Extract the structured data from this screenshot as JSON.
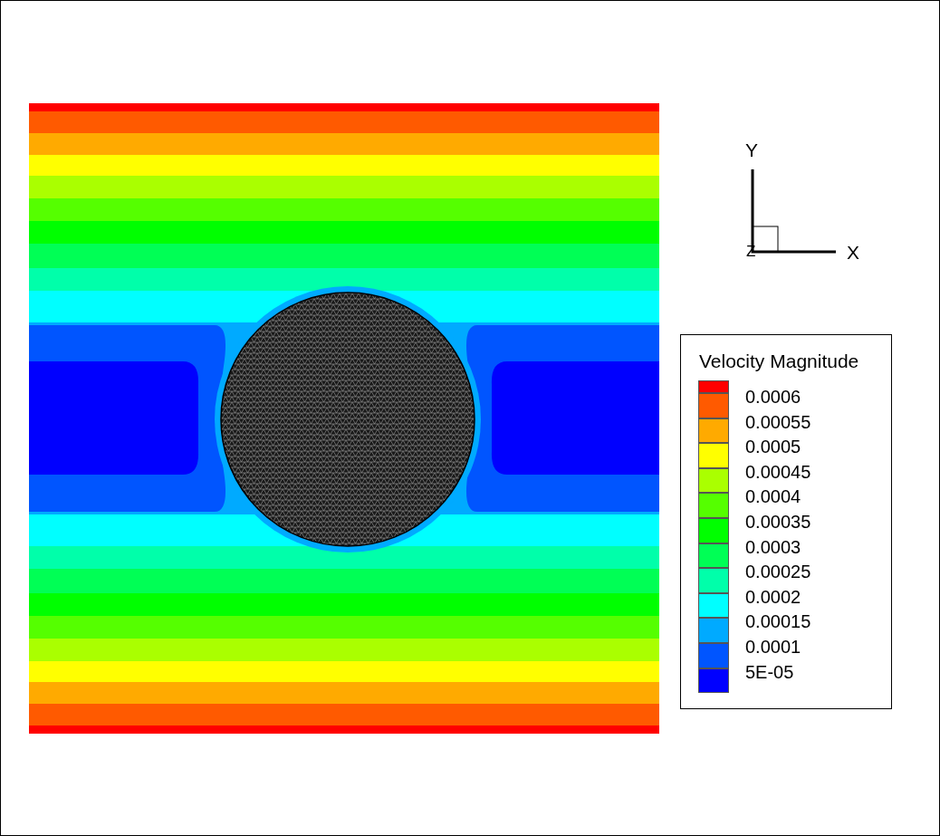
{
  "triad": {
    "x_label": "X",
    "y_label": "Y",
    "z_label": "Z"
  },
  "legend": {
    "title": "Velocity Magnitude",
    "bands": [
      {
        "color": "#ff0000"
      },
      {
        "color": "#ff5a00",
        "label": "0.0006"
      },
      {
        "color": "#ffaa00",
        "label": "0.00055"
      },
      {
        "color": "#ffff00",
        "label": "0.0005"
      },
      {
        "color": "#aaff00",
        "label": "0.00045"
      },
      {
        "color": "#55ff00",
        "label": "0.0004"
      },
      {
        "color": "#00ff00",
        "label": "0.00035"
      },
      {
        "color": "#00ff55",
        "label": "0.0003"
      },
      {
        "color": "#00ffaa",
        "label": "0.00025"
      },
      {
        "color": "#00ffff",
        "label": "0.0002"
      },
      {
        "color": "#00aaff",
        "label": "0.00015"
      },
      {
        "color": "#0055ff",
        "label": "0.0001"
      },
      {
        "color": "#0000ff",
        "label": "5E-05"
      }
    ]
  }
}
